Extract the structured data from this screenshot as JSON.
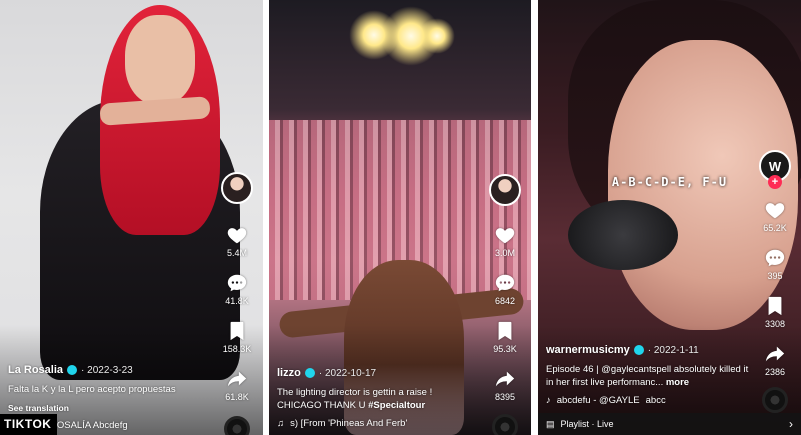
{
  "panels": [
    {
      "author": "La Rosalia",
      "date": "· 2022-3-23",
      "caption": "Falta la K y la L pero acepto propuestas",
      "see_translation": "See translation",
      "music": "ROSALÍA    Abcdefg",
      "likes": "5.4M",
      "comments": "41.8K",
      "saves": "158.3K",
      "shares": "61.8K"
    },
    {
      "author": "lizzo",
      "date": "· 2022-10-17",
      "caption_text": "The lighting director is gettin a raise ! CHICAGO THANK U ",
      "caption_tag": "#Specialtour",
      "music": "s) [From 'Phineas And Ferb'",
      "likes": "3.0M",
      "comments": "6842",
      "saves": "95.3K",
      "shares": "8395"
    },
    {
      "author": "warnermusicmy",
      "date": "· 2022-1-11",
      "caption_text": "Episode 46 | @gaylecantspell absolutely killed it in her first live performanc... ",
      "more_label": "more",
      "music": "abcdefu - @GAYLE",
      "music_extra": "abcc",
      "lyrics": "A-B-C-D-E, F-U",
      "likes": "65.2K",
      "comments": "395",
      "saves": "3308",
      "shares": "2386",
      "playlist_label": "Playlist · Live",
      "avatar_text": "W"
    }
  ],
  "badge": "TIKTOK"
}
